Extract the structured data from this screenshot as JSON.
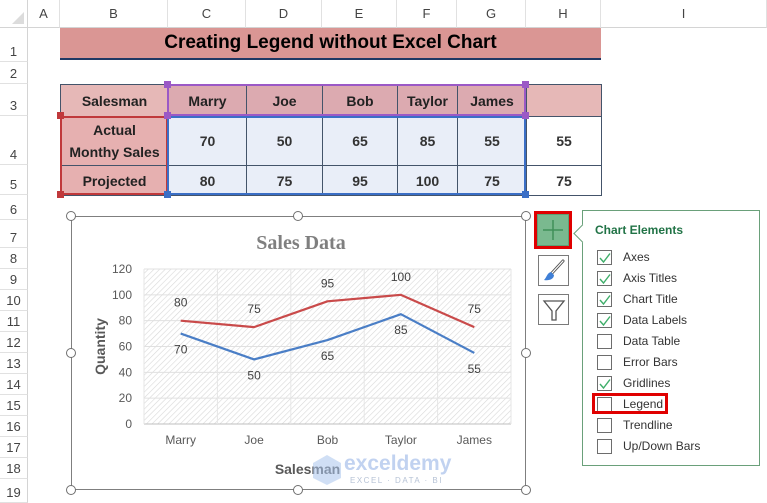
{
  "spreadsheet": {
    "column_headers": [
      "A",
      "B",
      "C",
      "D",
      "E",
      "F",
      "G",
      "H",
      "I"
    ],
    "row_headers": [
      "1",
      "2",
      "3",
      "4",
      "5",
      "6",
      "7",
      "8",
      "9",
      "10",
      "11",
      "12",
      "13",
      "14",
      "15",
      "16",
      "17",
      "18",
      "19"
    ]
  },
  "title_cell": "Creating Legend without Excel Chart",
  "table": {
    "header_label": "Salesman",
    "names": [
      "Marry",
      "Joe",
      "Bob",
      "Taylor",
      "James"
    ],
    "rows": [
      {
        "label": "Actual\nMonthy Sales",
        "label_line1": "Actual",
        "label_line2": "Monthy Sales",
        "values": [
          "70",
          "50",
          "65",
          "85",
          "55"
        ],
        "extra": "55"
      },
      {
        "label": "Projected",
        "values": [
          "80",
          "75",
          "95",
          "100",
          "75"
        ],
        "extra": "75"
      }
    ]
  },
  "chart_data": {
    "type": "line",
    "title": "Sales Data",
    "xlabel": "Salesman",
    "ylabel": "Quantity",
    "categories": [
      "Marry",
      "Joe",
      "Bob",
      "Taylor",
      "James"
    ],
    "ylim": [
      0,
      120
    ],
    "yticks": [
      0,
      20,
      40,
      60,
      80,
      100,
      120
    ],
    "grid": true,
    "legend": "none",
    "series": [
      {
        "name": "Actual Monthy Sales",
        "color": "#4a7ec6",
        "values": [
          70,
          50,
          65,
          85,
          55
        ],
        "label_position": "below"
      },
      {
        "name": "Projected",
        "color": "#c94a4a",
        "values": [
          80,
          75,
          95,
          100,
          75
        ],
        "label_position": "above"
      }
    ]
  },
  "chart_tools": {
    "buttons": [
      {
        "name": "chart-elements",
        "icon": "plus-icon",
        "active": true
      },
      {
        "name": "chart-styles",
        "icon": "brush-icon"
      },
      {
        "name": "chart-filters",
        "icon": "funnel-icon"
      }
    ]
  },
  "chart_elements_panel": {
    "title": "Chart Elements",
    "items": [
      {
        "label": "Axes",
        "checked": true
      },
      {
        "label": "Axis Titles",
        "checked": true
      },
      {
        "label": "Chart Title",
        "checked": true
      },
      {
        "label": "Data Labels",
        "checked": true
      },
      {
        "label": "Data Table",
        "checked": false
      },
      {
        "label": "Error Bars",
        "checked": false
      },
      {
        "label": "Gridlines",
        "checked": true
      },
      {
        "label": "Legend",
        "checked": false,
        "highlighted": true
      },
      {
        "label": "Trendline",
        "checked": false
      },
      {
        "label": "Up/Down Bars",
        "checked": false
      }
    ]
  },
  "watermark": {
    "brand": "exceldemy",
    "tagline": "EXCEL · DATA · BI"
  },
  "colors": {
    "accent_green": "#217346",
    "highlight_red": "#e00000",
    "title_fill": "#da9694"
  }
}
